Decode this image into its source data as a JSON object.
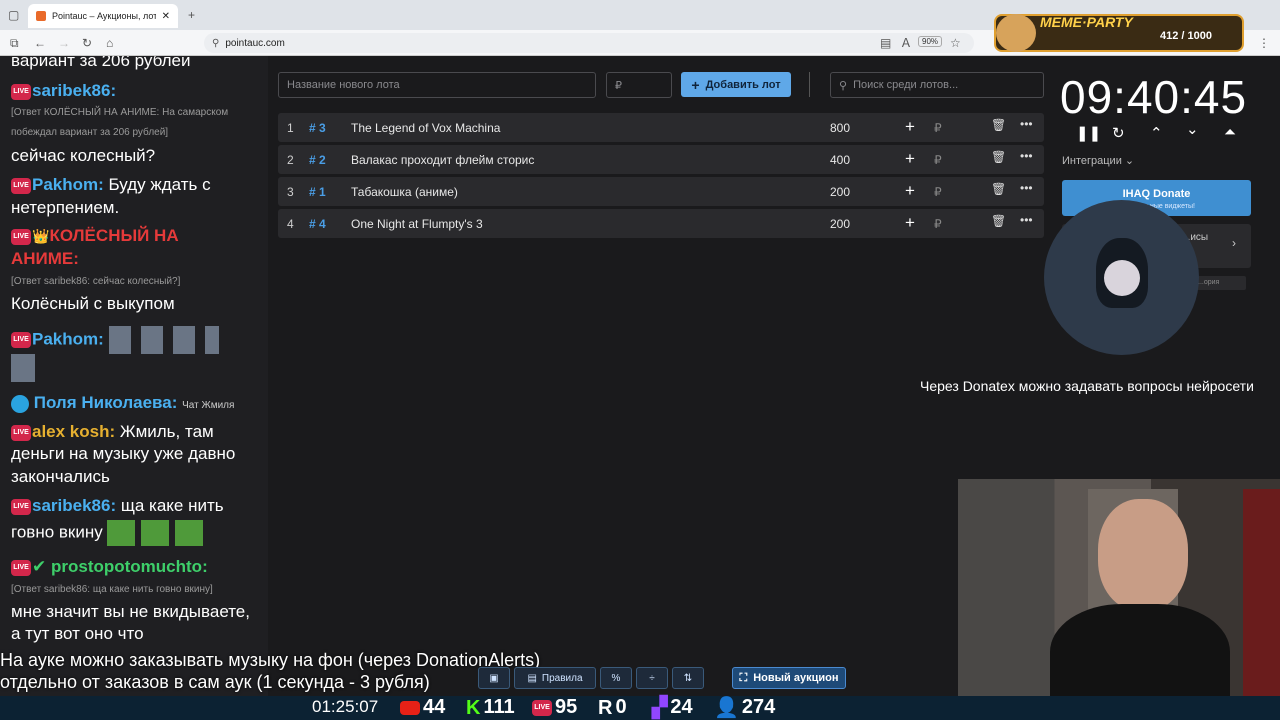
{
  "browser": {
    "tab_title": "Pointauc – Аукционы, лотереи",
    "url": "pointauc.com",
    "zoom": "90%"
  },
  "meme_party": {
    "title": "MEME·PARTY",
    "count": "412 / 1000"
  },
  "chat": {
    "lines": [
      {
        "text": "вариант за 206 рублей"
      },
      {
        "nick": "saribek86:",
        "text": ""
      },
      {
        "reply": "[Ответ КОЛЁСНЫЙ НА АНИМЕ: На самарском"
      },
      {
        "reply": "побеждал вариант за 206 рублей]"
      },
      {
        "text": "сейчас колесный?"
      },
      {
        "nick": "Pakhom:",
        "text": " Буду ждать с"
      },
      {
        "text": "нетерпением."
      },
      {
        "nick": "КОЛЁСНЫЙ НА"
      },
      {
        "nick": "АНИМЕ:"
      },
      {
        "reply": "[Ответ saribek86: сейчас колесный?]"
      },
      {
        "text": "Колёсный с выкупом"
      },
      {
        "nick": "Pakhom:"
      },
      {
        "nick": "Поля Николаева:",
        "text": "Чат Жмиля"
      },
      {
        "nick": "alex kosh:",
        "text": " Жмиль, там"
      },
      {
        "text": "деньги на музыку уже давно"
      },
      {
        "text": "закончались"
      },
      {
        "nick": "saribek86:",
        "text": " ща каке нить"
      },
      {
        "text": "говно вкину"
      },
      {
        "nick": "prostopotomuchto:"
      },
      {
        "reply": "[Ответ saribek86: ща каке нить говно вкину]"
      },
      {
        "text": "мне значит вы не вкидываете,"
      },
      {
        "text": "а тут вот оно что"
      }
    ]
  },
  "auction": {
    "new_lot_placeholder": "Название нового лота",
    "amount_placeholder": "₽",
    "add_button": "Добавить лот",
    "search_placeholder": "Поиск среди лотов...",
    "lots": [
      {
        "index": "1",
        "number": "# 3",
        "name": "The Legend of Vox Machina",
        "amount": "800"
      },
      {
        "index": "2",
        "number": "# 2",
        "name": "Валакас проходит флейм сторис",
        "amount": "400"
      },
      {
        "index": "3",
        "number": "# 1",
        "name": "Табакошка (аниме)",
        "amount": "200"
      },
      {
        "index": "4",
        "number": "# 4",
        "name": "One Night at Flumpty's 3",
        "amount": "200"
      }
    ]
  },
  "right_panel": {
    "timer": "09:40:45",
    "integrations": "Интеграции",
    "donate_button": "IHAQ Donate",
    "donate_sub": "...уникальные виджеты!",
    "card2_text": "...исы",
    "card2_sub": "...ория"
  },
  "overlay": {
    "donatex": "Через Donatex можно задавать вопросы нейросети",
    "subtitle_line1": "На ауке можно заказывать музыку на фон (через DonationAlerts)",
    "subtitle_line2": "отдельно от заказов в сам аук (1 секунда - 3 рубля)"
  },
  "toolbar": {
    "rules": "Правила",
    "new_auction": "Новый аукцион"
  },
  "stats": {
    "time": "01:25:07",
    "youtube": "44",
    "kick": "111",
    "live": "95",
    "r": "0",
    "twitch": "24",
    "viewers": "274"
  },
  "colors": {
    "accent": "#5fa8e8",
    "lot_number": "#4a9ee6",
    "chat_red": "#e53a3a",
    "chat_blue": "#4ab0f0"
  }
}
